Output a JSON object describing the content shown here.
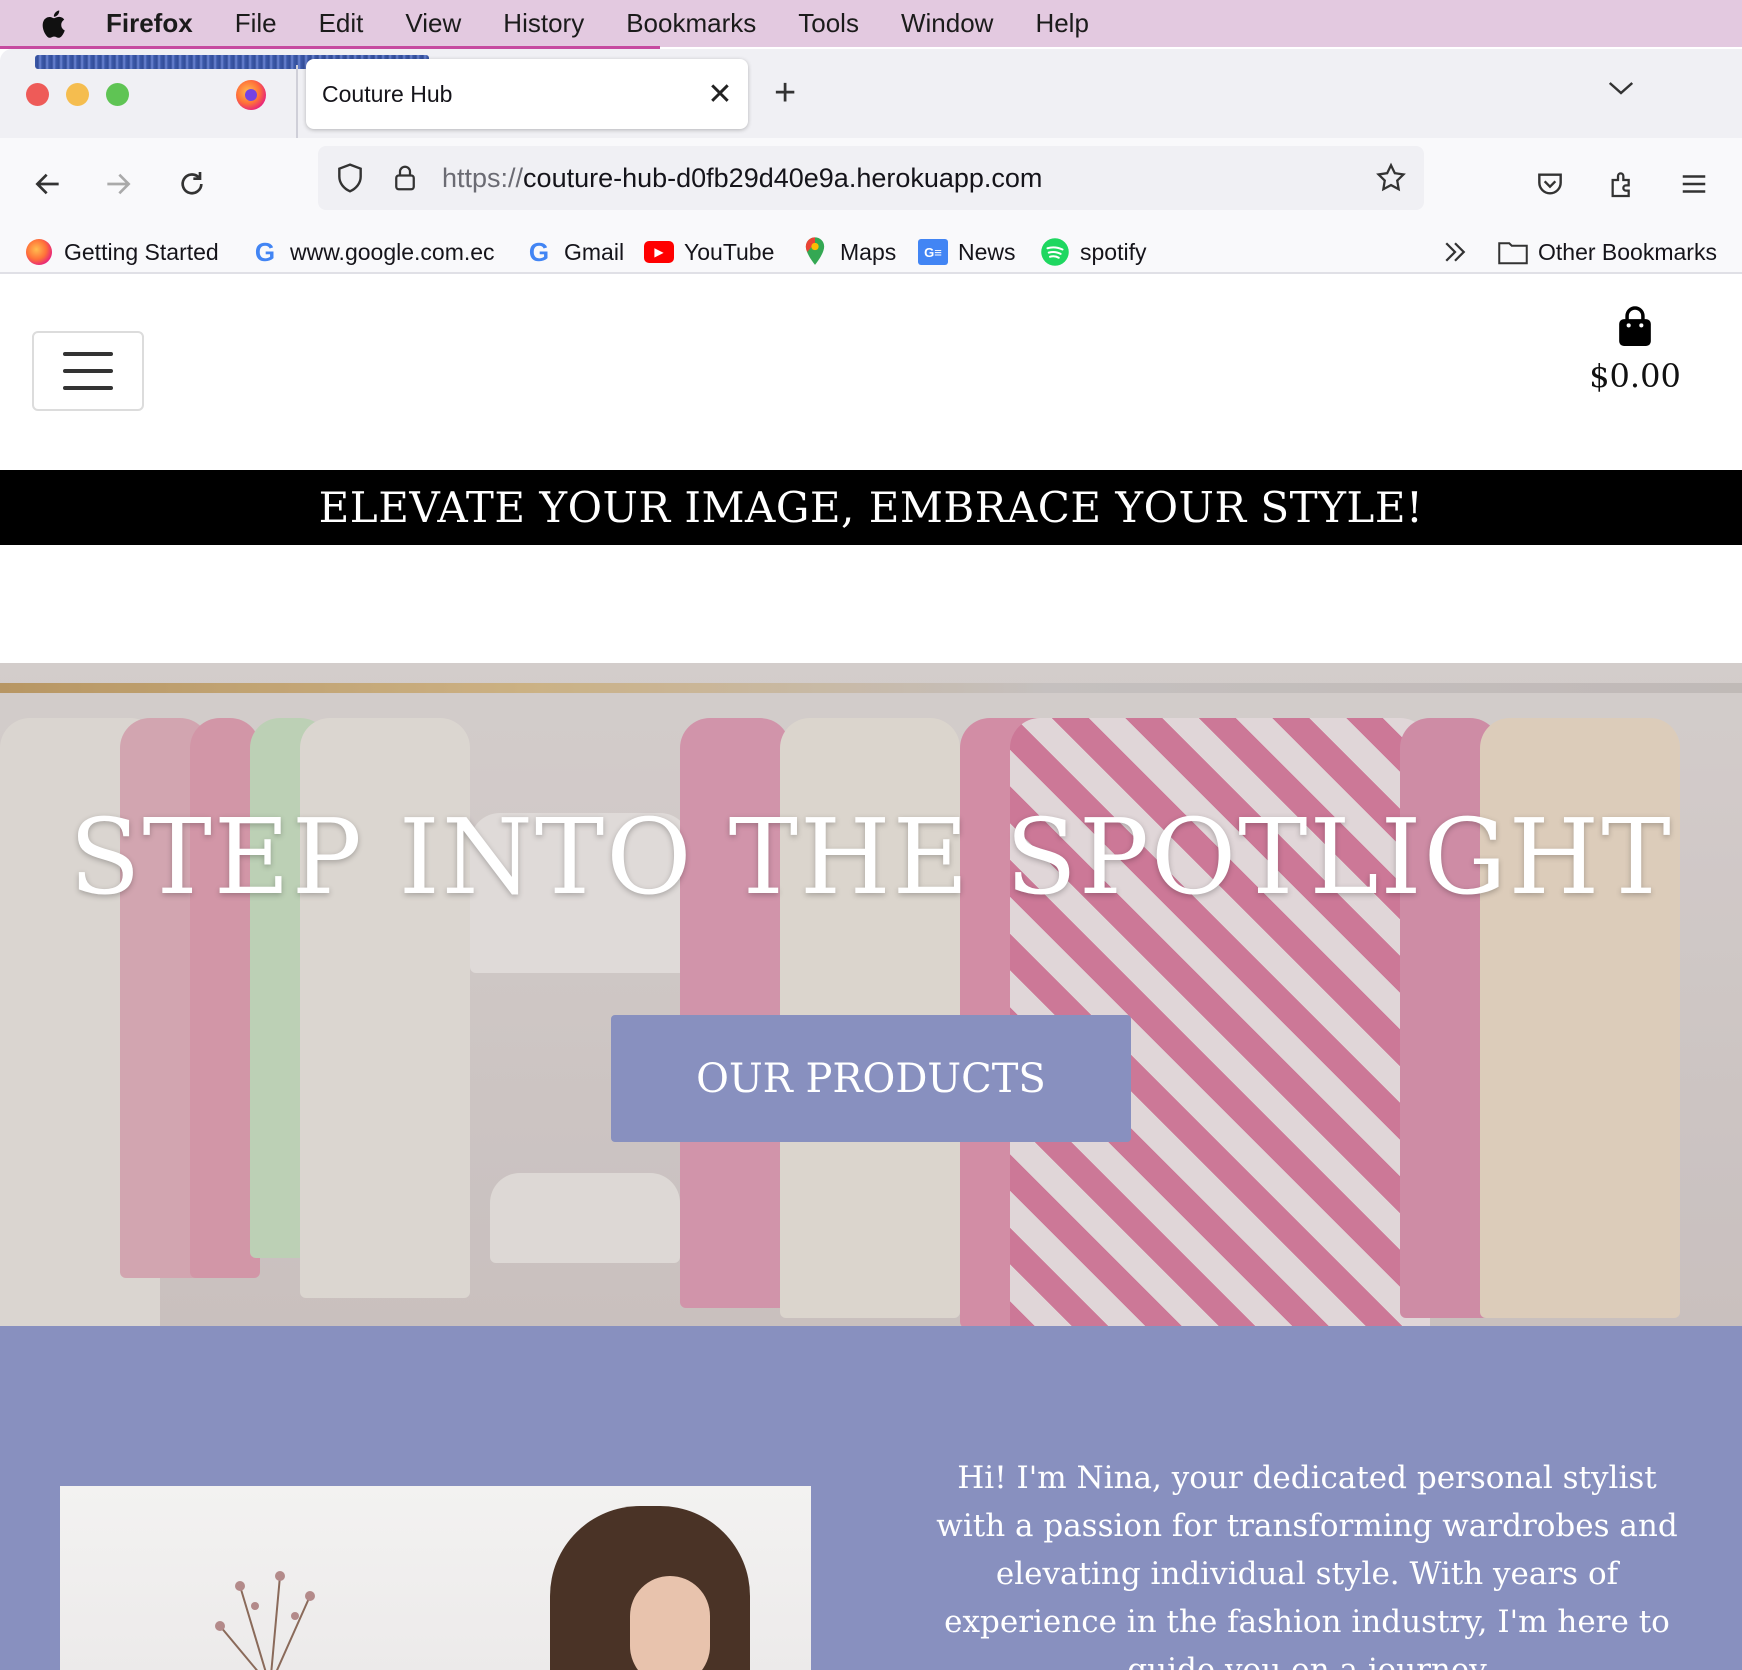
{
  "menubar": {
    "app": "Firefox",
    "items": [
      "File",
      "Edit",
      "View",
      "History",
      "Bookmarks",
      "Tools",
      "Window",
      "Help"
    ]
  },
  "tab": {
    "title": "Couture Hub"
  },
  "urlbar": {
    "scheme": "https://",
    "host": "couture-hub-d0fb29d40e9a.herokuapp.com"
  },
  "bookmarks": {
    "items": [
      "Getting Started",
      "www.google.com.ec",
      "Gmail",
      "YouTube",
      "Maps",
      "News",
      "spotify"
    ],
    "other": "Other Bookmarks"
  },
  "site": {
    "cart_total": "$0.00",
    "banner": "ELEVATE YOUR IMAGE, EMBRACE YOUR STYLE!",
    "hero_title": "STEP INTO THE SPOTLIGHT",
    "cta": "OUR PRODUCTS",
    "about_text": "Hi! I'm Nina, your dedicated personal stylist with a passion for transforming wardrobes and elevating individual style. With years of experience in the fashion industry, I'm here to guide you on a journey"
  },
  "colors": {
    "menubar": "#e3c9e0",
    "accent": "#8890bf",
    "banner": "#000000"
  },
  "icons": [
    "apple-icon",
    "firefox-icon",
    "close-icon",
    "plus-icon",
    "chevron-down-icon",
    "back-icon",
    "forward-icon",
    "reload-icon",
    "shield-icon",
    "lock-icon",
    "star-icon",
    "pocket-icon",
    "extensions-icon",
    "menu-icon",
    "overflow-icon",
    "folder-icon",
    "shopping-bag-icon"
  ]
}
